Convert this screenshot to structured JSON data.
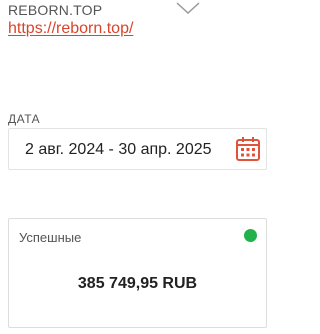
{
  "header": {
    "site_name": "REBORN.TOP",
    "site_url": "https://reborn.top/",
    "toggle_icon": "chevron-down-icon"
  },
  "date_filter": {
    "label": "ДАТА",
    "range_value": "2 авг. 2024 - 30 апр. 2025",
    "icon": "calendar-icon",
    "icon_color": "#e0533a"
  },
  "stat_card": {
    "label": "Успешные",
    "value": "385 749,95 RUB",
    "status_color": "#22b24c"
  },
  "colors": {
    "link": "#d9452b",
    "accent": "#e0533a",
    "success": "#22b24c"
  }
}
